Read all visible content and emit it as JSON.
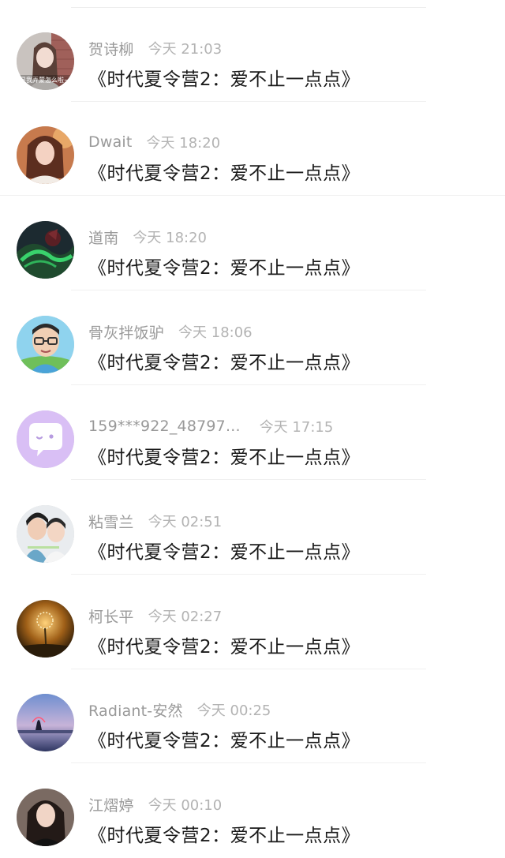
{
  "messages": [
    {
      "username": "贺诗柳",
      "time": "今天 21:03",
      "text": "《时代夏令营2：爱不止一点点》",
      "avatar_icon": "avatar-girl-brick-wall-photo",
      "avatar_caption": "是我弄蒙怎么啦~"
    },
    {
      "username": "Dwait",
      "time": "今天 18:20",
      "text": "《时代夏令营2：爱不止一点点》",
      "avatar_icon": "avatar-girl-warm-tone-photo"
    },
    {
      "username": "道南",
      "time": "今天 18:20",
      "text": "《时代夏令营2：爱不止一点点》",
      "avatar_icon": "avatar-green-dragon-art"
    },
    {
      "username": "骨灰拌饭驴",
      "time": "今天 18:06",
      "text": "《时代夏令营2：爱不止一点点》",
      "avatar_icon": "avatar-glasses-man-cartoon"
    },
    {
      "username": "159***922_48797...",
      "time": "今天 17:15",
      "text": "《时代夏令营2：爱不止一点点》",
      "avatar_icon": "avatar-default-purple-chat-bubble"
    },
    {
      "username": "粘雪兰",
      "time": "今天 02:51",
      "text": "《时代夏令营2：爱不止一点点》",
      "avatar_icon": "avatar-couple-photo"
    },
    {
      "username": "柯长平",
      "time": "今天 02:27",
      "text": "《时代夏令营2：爱不止一点点》",
      "avatar_icon": "avatar-dandelion-sunset-photo"
    },
    {
      "username": "Radiant-安然",
      "time": "今天 00:25",
      "text": "《时代夏令营2：爱不止一点点》",
      "avatar_icon": "avatar-sunset-silhouette-photo"
    },
    {
      "username": "江熠婷",
      "time": "今天 00:10",
      "text": "《时代夏令营2：爱不止一点点》",
      "avatar_icon": "avatar-girl-dark-hair-photo"
    }
  ]
}
